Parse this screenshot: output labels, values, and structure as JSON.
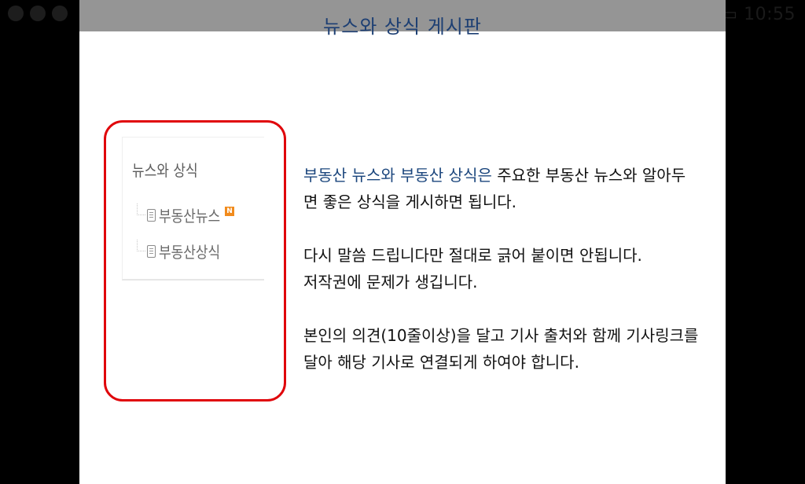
{
  "status_bar": {
    "time": "10:55",
    "left_icons": [
      "app-icon",
      "chat-icon",
      "phone-icon"
    ],
    "right_icons": [
      "mute-icon",
      "alarm-icon",
      "wifi-icon",
      "signal-icon",
      "battery-icon"
    ]
  },
  "slide": {
    "title": "뉴스와 상식 게시판",
    "screenshot": {
      "title": "뉴스와 상식",
      "items": [
        {
          "label": "부동산뉴스",
          "badge": "N"
        },
        {
          "label": "부동산상식"
        }
      ]
    },
    "paragraphs": [
      {
        "lines": [
          {
            "highlight": "부동산 뉴스와 부동산 상식은",
            "text": " 주요한 부동산 뉴스와 알아두"
          },
          {
            "highlight": "",
            "text": "면 좋은 상식을 게시하면 됩니다."
          }
        ]
      },
      {
        "lines": [
          {
            "highlight": "",
            "text": "다시 말씀 드립니다만 절대로 긁어 붙이면 안됩니다."
          },
          {
            "highlight": "",
            "text": "저작권에 문제가 생깁니다."
          }
        ]
      },
      {
        "lines": [
          {
            "highlight": "",
            "text": "본인의 의견(10줄이상)을 달고 기사 출처와 함께 기사링크를"
          },
          {
            "highlight": "",
            "text": "달아 해당 기사로 연결되게 하여야 합니다."
          }
        ]
      }
    ],
    "colors": {
      "title": "#1d3f73",
      "highlight": "#1b467d",
      "frame": "#e0060b",
      "badge": "#f18b1d"
    }
  }
}
